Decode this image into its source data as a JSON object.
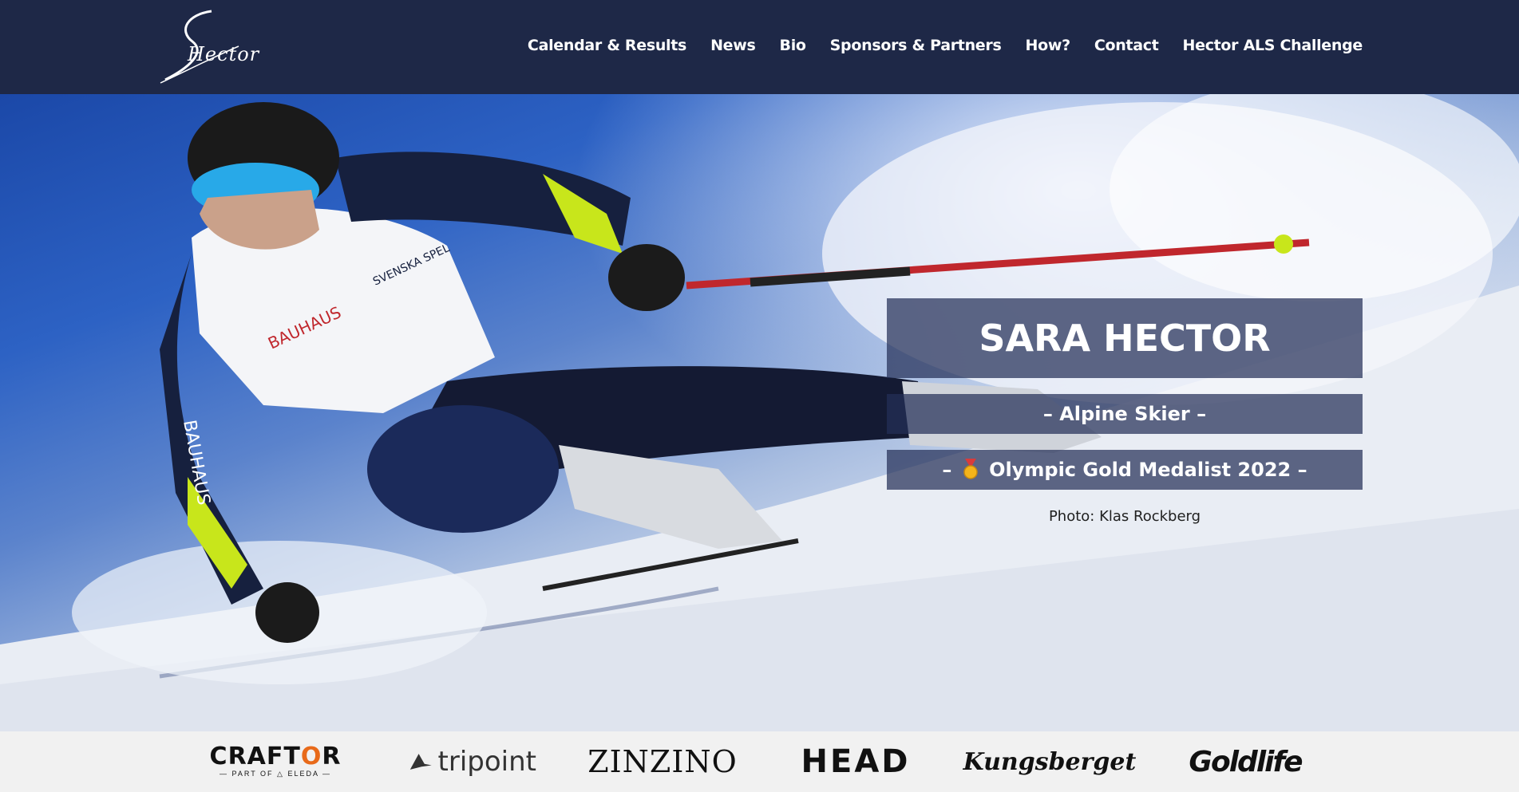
{
  "header": {
    "logo_text": "Hector",
    "nav": [
      "Calendar & Results",
      "News",
      "Bio",
      "Sponsors & Partners",
      "How?",
      "Contact",
      "Hector ALS Challenge"
    ]
  },
  "hero": {
    "name": "SARA HECTOR",
    "subtitle": "– Alpine Skier –",
    "medal_prefix": "–",
    "medal_text": "Olympic Gold Medalist 2022 –",
    "photo_credit": "Photo: Klas Rockberg"
  },
  "sponsors": {
    "craftor_main_a": "CRAFT",
    "craftor_main_o": "O",
    "craftor_main_b": "R",
    "craftor_sub": "— PART OF △ ELEDA —",
    "tripoint": "tripoint",
    "zinzino": "ZINZINO",
    "head": "HEAD",
    "kungsberget": "Kungsberget",
    "goldlife": "Goldlife"
  },
  "colors": {
    "header_bg": "#1e2847",
    "caption_bg": "rgba(36,47,88,0.72)",
    "accent_orange": "#e86a1a"
  }
}
